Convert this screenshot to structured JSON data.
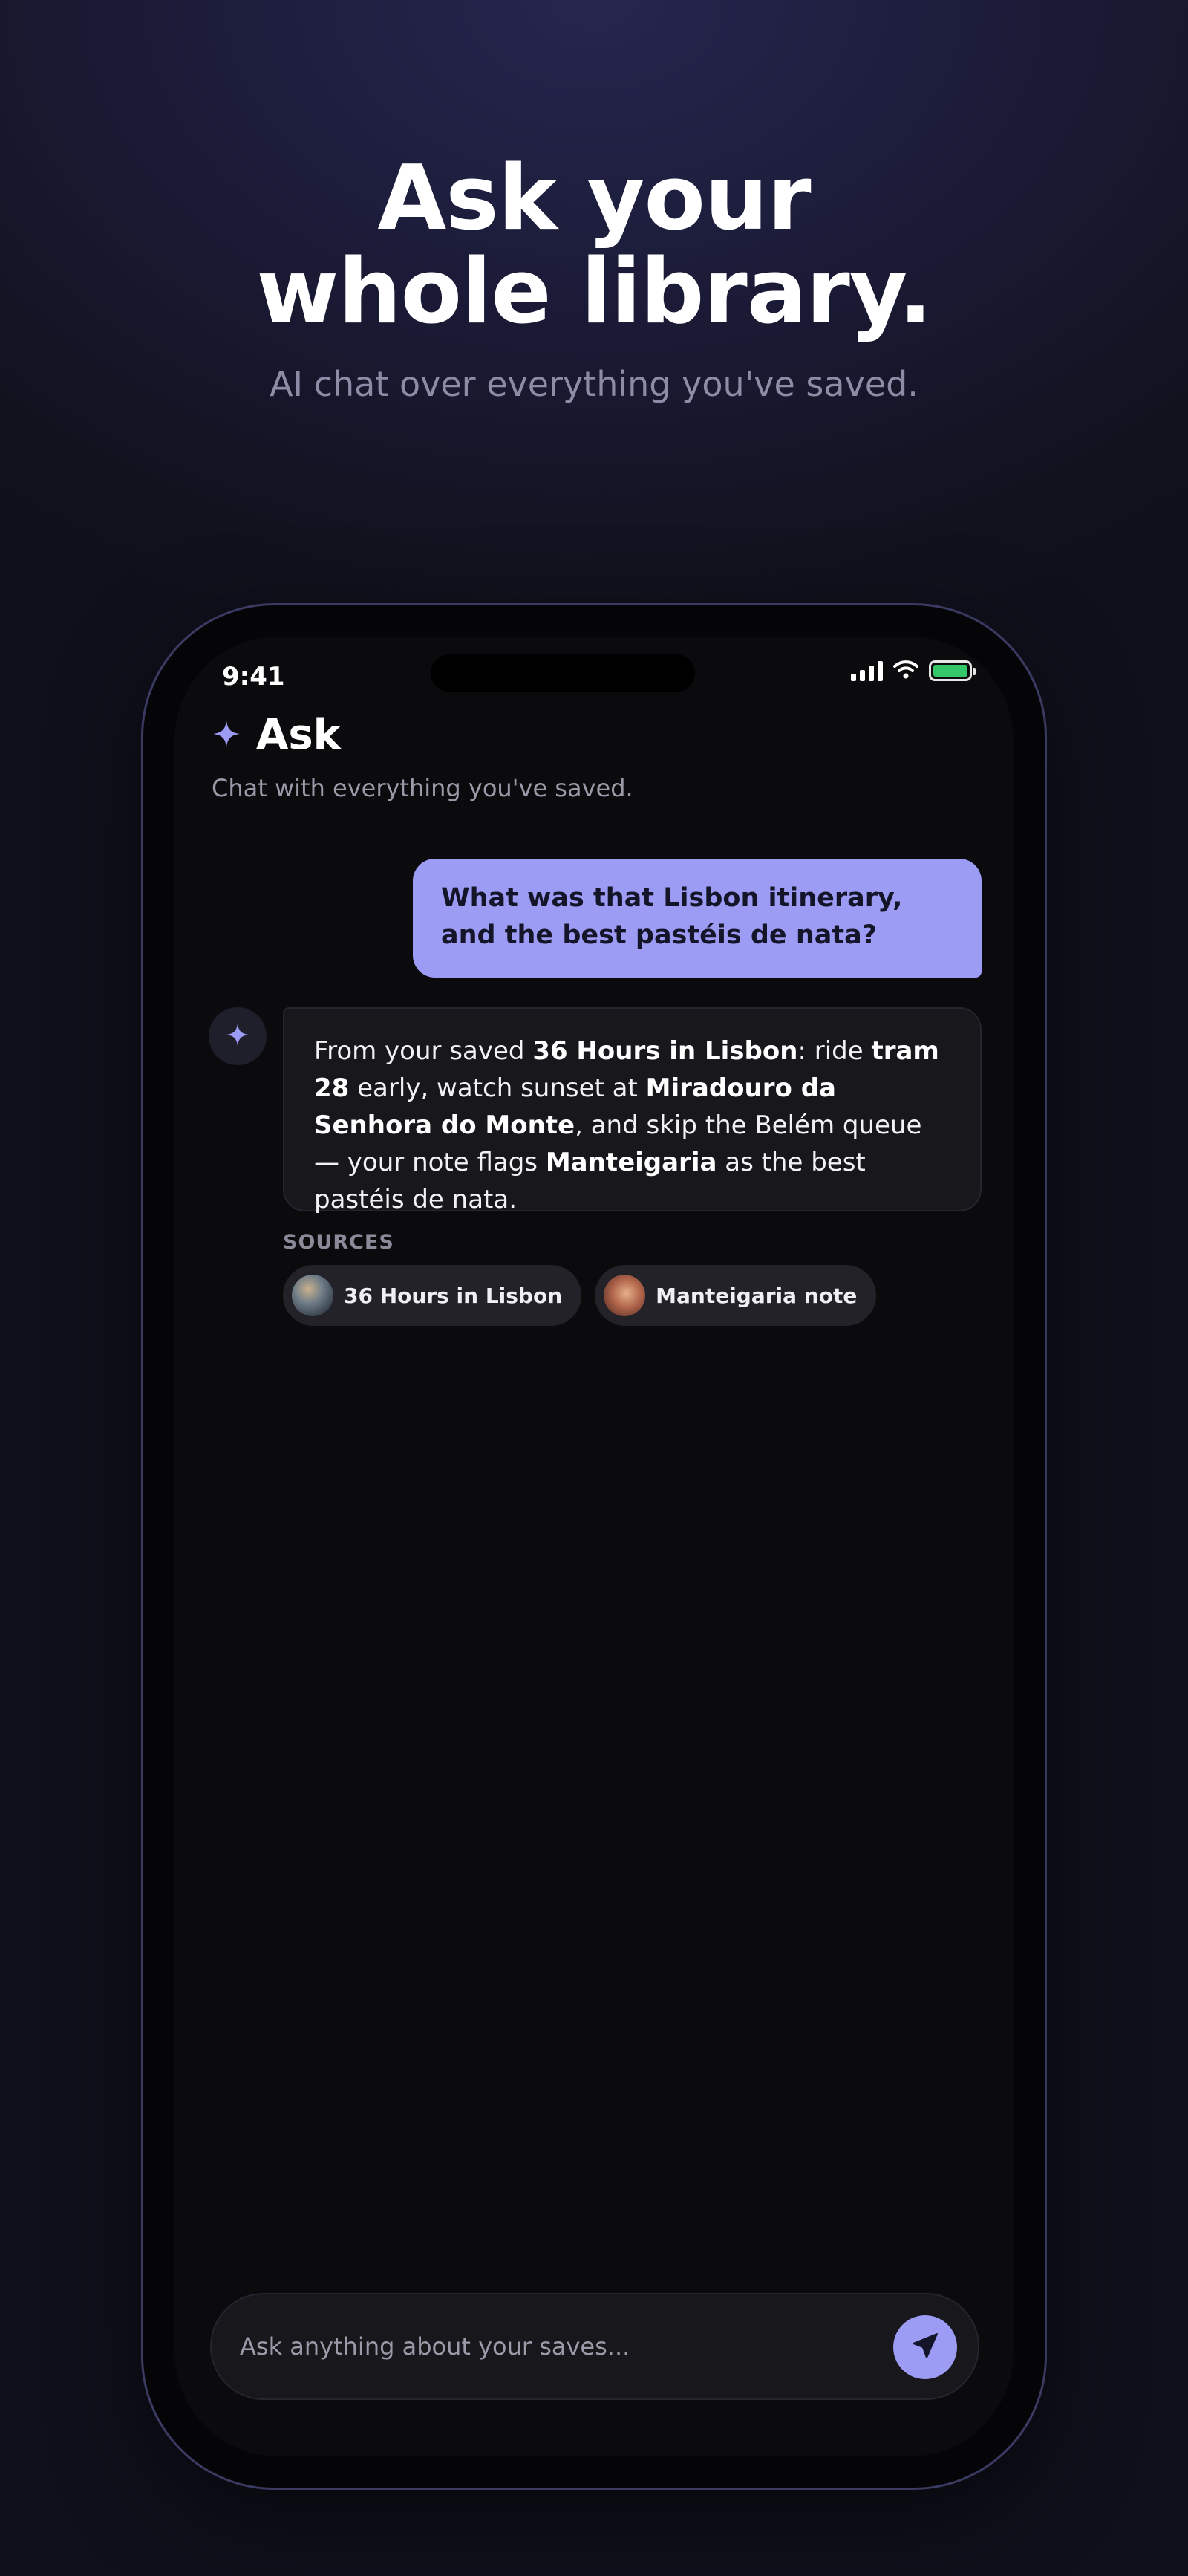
{
  "hero": {
    "title_line1": "Ask your",
    "title_line2": "whole library.",
    "subtitle": "AI chat over everything you've saved."
  },
  "status_bar": {
    "time": "9:41",
    "battery_color": "#34c769"
  },
  "header": {
    "title": "Ask",
    "subtitle": "Chat with everything you've saved.",
    "icon": "sparkle-icon",
    "accent_color": "#9d9cf5"
  },
  "conversation": {
    "user_message": "What was that Lisbon itinerary, and the best pastéis de nata?",
    "ai_message": {
      "t1": "From your saved ",
      "b1": "36 Hours in Lisbon",
      "t2": ": ride ",
      "b2": "tram 28",
      "t3": " early, watch sunset at ",
      "b3": "Miradouro da Senhora do Monte",
      "t4": ", and skip the Belém queue — your note flags ",
      "b4": "Manteigaria",
      "t5": " as the best pastéis de nata."
    },
    "sources_label": "SOURCES",
    "sources": [
      {
        "label": "36 Hours in Lisbon"
      },
      {
        "label": "Manteigaria note"
      }
    ]
  },
  "composer": {
    "placeholder": "Ask anything about your saves...",
    "send_icon": "send-arrow-icon"
  }
}
